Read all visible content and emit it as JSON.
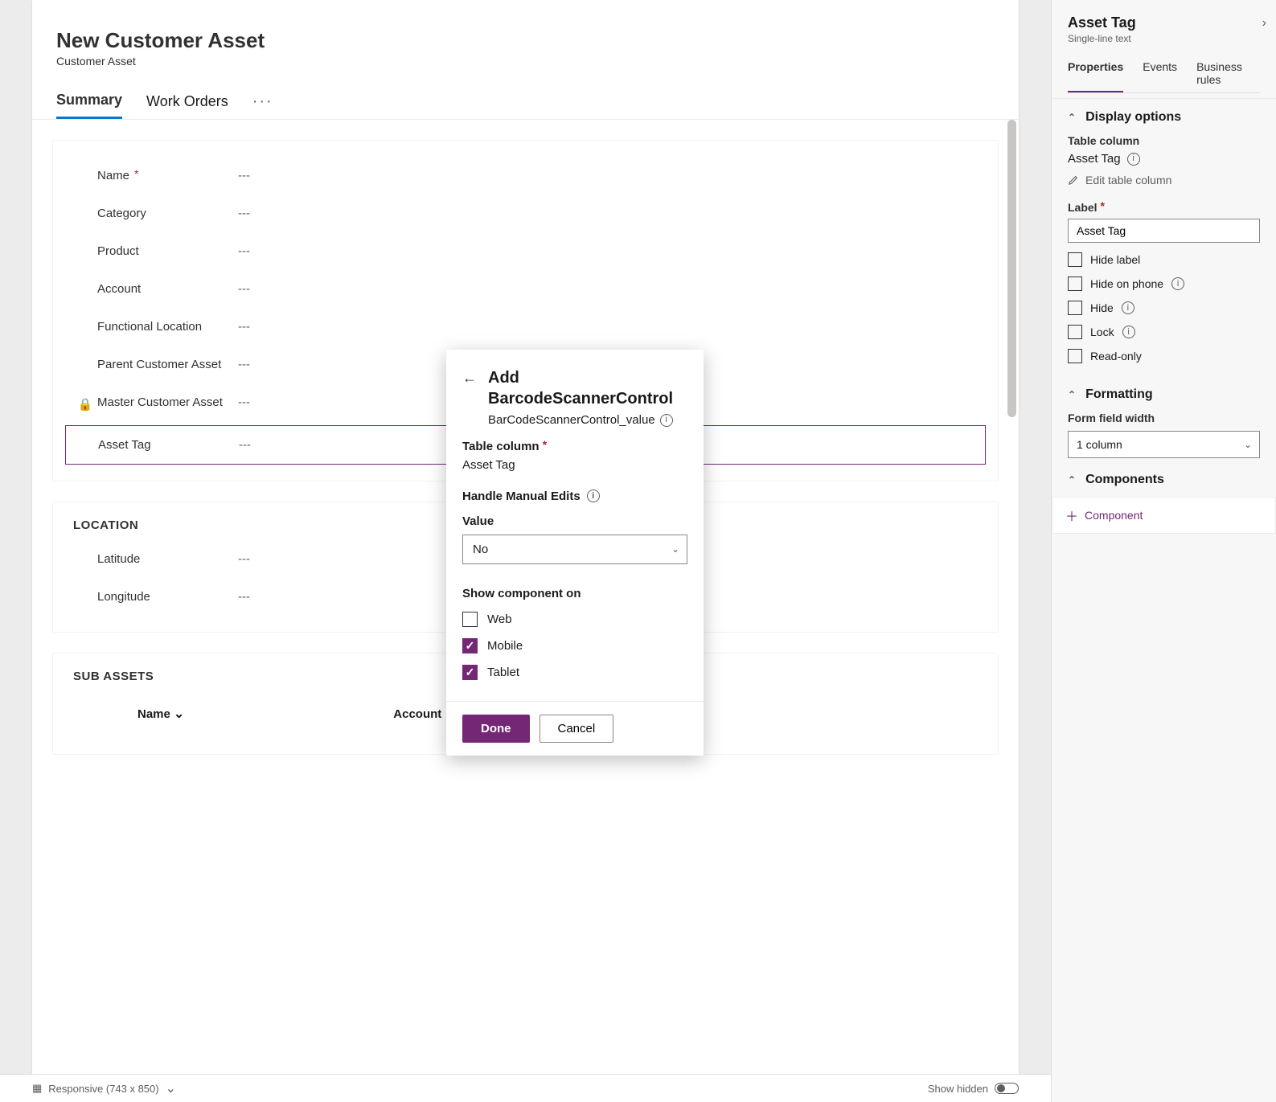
{
  "form": {
    "title": "New Customer Asset",
    "subtitle": "Customer Asset",
    "tabs": {
      "summary": "Summary",
      "workOrders": "Work Orders",
      "more": "···"
    },
    "emptyValue": "---",
    "fields": [
      {
        "label": "Name",
        "required": true,
        "locked": false
      },
      {
        "label": "Category",
        "required": false,
        "locked": false
      },
      {
        "label": "Product",
        "required": false,
        "locked": false
      },
      {
        "label": "Account",
        "required": false,
        "locked": false
      },
      {
        "label": "Functional Location",
        "required": false,
        "locked": false
      },
      {
        "label": "Parent Customer Asset",
        "required": false,
        "locked": false
      },
      {
        "label": "Master Customer Asset",
        "required": false,
        "locked": true
      },
      {
        "label": "Asset Tag",
        "required": false,
        "locked": false,
        "selected": true
      }
    ],
    "locationSection": {
      "title": "LOCATION",
      "latitudeLabel": "Latitude",
      "longitudeLabel": "Longitude"
    },
    "subAssetsSection": {
      "title": "SUB ASSETS",
      "colName": "Name",
      "colAccount": "Account"
    }
  },
  "popup": {
    "title": "Add BarcodeScannerControl",
    "subtitle": "BarCodeScannerControl_value",
    "tableColumnLabel": "Table column",
    "tableColumnValue": "Asset Tag",
    "handleManualLabel": "Handle Manual Edits",
    "valueLabel": "Value",
    "valueSelected": "No",
    "showOnLabel": "Show component on",
    "optWeb": "Web",
    "optMobile": "Mobile",
    "optTablet": "Tablet",
    "doneLabel": "Done",
    "cancelLabel": "Cancel"
  },
  "rightPanel": {
    "title": "Asset Tag",
    "subtitle": "Single-line text",
    "tabs": {
      "properties": "Properties",
      "events": "Events",
      "businessRules": "Business rules"
    },
    "displayOptions": {
      "heading": "Display options",
      "tableColumnLabel": "Table column",
      "tableColumnValue": "Asset Tag",
      "editLink": "Edit table column",
      "labelLabel": "Label",
      "labelValue": "Asset Tag",
      "hideLabel": "Hide label",
      "hideOnPhone": "Hide on phone",
      "hide": "Hide",
      "lock": "Lock",
      "readOnly": "Read-only"
    },
    "formatting": {
      "heading": "Formatting",
      "widthLabel": "Form field width",
      "widthValue": "1 column"
    },
    "components": {
      "heading": "Components",
      "addLabel": "Component"
    }
  },
  "bottomBar": {
    "responsive": "Responsive (743 x 850)",
    "showHidden": "Show hidden"
  },
  "glyphs": {
    "lock": "🔒",
    "chevronDown": "⌄",
    "chevronRight": "›",
    "caret": "⌃",
    "backArrow": "←",
    "check": "✓",
    "plus": "＋",
    "info": "i",
    "layout": "▦"
  }
}
